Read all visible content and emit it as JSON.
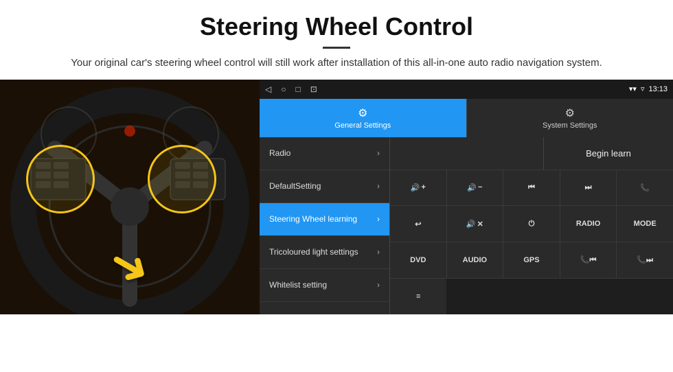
{
  "header": {
    "title": "Steering Wheel Control",
    "divider": true,
    "subtitle": "Your original car's steering wheel control will still work after installation of this all-in-one auto radio navigation system."
  },
  "status_bar": {
    "nav_back": "◁",
    "nav_home": "○",
    "nav_square": "□",
    "nav_cast": "⊡",
    "signal": "▾▾",
    "wifi": "▿",
    "time": "13:13"
  },
  "tabs": {
    "general": {
      "label": "General Settings",
      "icon": "⚙"
    },
    "system": {
      "label": "System Settings",
      "icon": "⚙"
    }
  },
  "menu": {
    "items": [
      {
        "label": "Radio",
        "active": false
      },
      {
        "label": "DefaultSetting",
        "active": false
      },
      {
        "label": "Steering Wheel learning",
        "active": true
      },
      {
        "label": "Tricoloured light settings",
        "active": false
      },
      {
        "label": "Whitelist setting",
        "active": false
      }
    ]
  },
  "controls": {
    "begin_learn": "Begin learn",
    "button_rows": [
      [
        {
          "label": "🔊+",
          "name": "vol-up"
        },
        {
          "label": "🔊−",
          "name": "vol-down"
        },
        {
          "label": "⏮",
          "name": "prev-track"
        },
        {
          "label": "⏭",
          "name": "next-track"
        },
        {
          "label": "📞",
          "name": "call"
        }
      ],
      [
        {
          "label": "↩",
          "name": "hang-up"
        },
        {
          "label": "🔊✕",
          "name": "mute"
        },
        {
          "label": "⏻",
          "name": "power"
        },
        {
          "label": "RADIO",
          "name": "radio"
        },
        {
          "label": "MODE",
          "name": "mode"
        }
      ],
      [
        {
          "label": "DVD",
          "name": "dvd"
        },
        {
          "label": "AUDIO",
          "name": "audio"
        },
        {
          "label": "GPS",
          "name": "gps"
        },
        {
          "label": "📞⏮",
          "name": "call-prev"
        },
        {
          "label": "📞⏭",
          "name": "call-next"
        }
      ],
      [
        {
          "label": "≡",
          "name": "menu-icon"
        }
      ]
    ]
  }
}
